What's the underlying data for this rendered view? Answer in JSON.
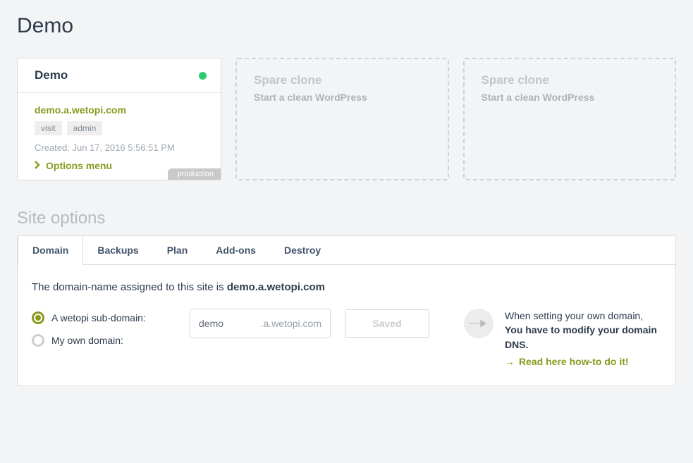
{
  "page": {
    "title": "Demo"
  },
  "site_card": {
    "name": "Demo",
    "status_color": "#2ecc71",
    "domain": "demo.a.wetopi.com",
    "visit_label": "visit",
    "admin_label": "admin",
    "created_label": "Created: Jun 17, 2016 5:56:51 PM",
    "options_menu_label": "Options menu",
    "badge": "production"
  },
  "clone_slots": [
    {
      "title": "Spare clone",
      "subtitle": "Start a clean WordPress"
    },
    {
      "title": "Spare clone",
      "subtitle": "Start a clean WordPress"
    }
  ],
  "section": {
    "title": "Site options"
  },
  "tabs": {
    "domain": "Domain",
    "backups": "Backups",
    "plan": "Plan",
    "addons": "Add-ons",
    "destroy": "Destroy"
  },
  "domain_tab": {
    "intro_prefix": "The domain-name assigned to this site is ",
    "intro_domain": "demo.a.wetopi.com",
    "radio_subdomain": "A wetopi sub-domain:",
    "radio_own": "My own domain:",
    "subdomain_value": "demo",
    "subdomain_suffix": ".a.wetopi.com",
    "button_saved": "Saved",
    "info_line1": "When setting your own domain,",
    "info_line2": "You have to modify your domain DNS.",
    "info_link_arrow": "→",
    "info_link": "Read here how-to do it!"
  }
}
